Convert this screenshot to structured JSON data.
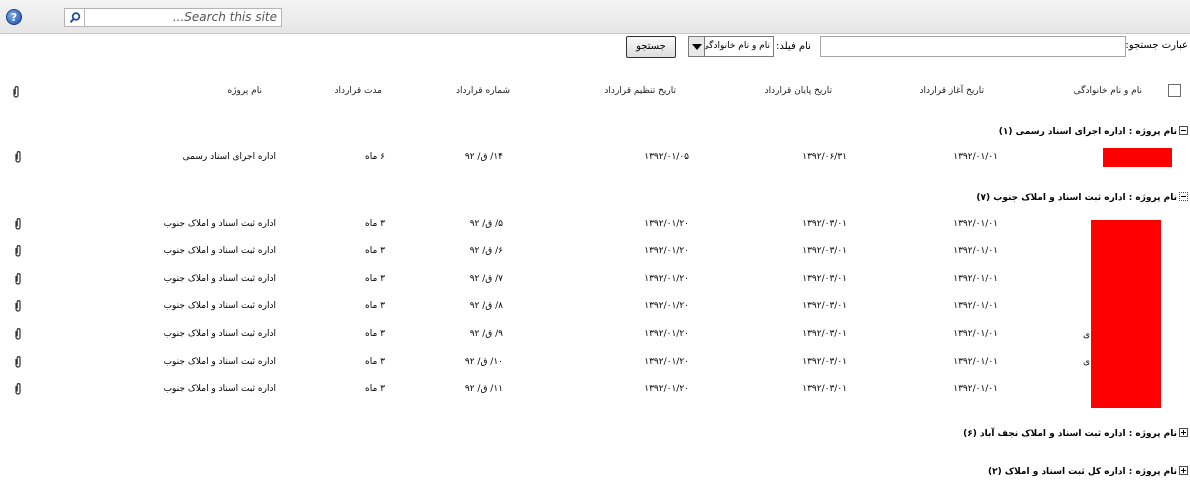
{
  "topbar": {
    "help_icon": "?",
    "site_search_placeholder": "...Search this site"
  },
  "search": {
    "label": "عبارت جستجو:",
    "field_label": "نام فیلد:",
    "field_selected": "نام و نام خانوادگی",
    "button": "جستجو"
  },
  "columns": {
    "name": "نام و نام خانوادگی",
    "start": "تاریخ آغاز قرارداد",
    "end": "تاریخ پایان قرارداد",
    "draft": "تاریخ تنظیم قرارداد",
    "number": "شماره قرارداد",
    "duration": "مدت قرارداد",
    "project": "نام پروژه"
  },
  "groups": [
    {
      "label": "نام پروژه : اداره اجرای اسناد رسمی",
      "count": "(۱)"
    },
    {
      "label": "نام پروژه : اداره ثبت اسناد و املاک جنوب",
      "count": "(۷)"
    },
    {
      "label": "نام پروژه : اداره ثبت اسناد و املاک نجف آباد",
      "count": "(۶)"
    },
    {
      "label": "نام پروژه : اداره کل ثبت اسناد و املاک",
      "count": "(۲)"
    }
  ],
  "rows": [
    {
      "start": "۱۳۹۲/۰۱/۰۱",
      "end": "۱۳۹۲/۰۶/۳۱",
      "draft": "۱۳۹۲/۰۱/۰۵",
      "number": "۱۴/ ق/ ۹۲",
      "duration": "۶ ماه",
      "project": "اداره اجرای اسناد رسمی"
    },
    {
      "start": "۱۳۹۲/۰۱/۰۱",
      "end": "۱۳۹۲/۰۳/۰۱",
      "draft": "۱۳۹۲/۰۱/۲۰",
      "number": "۵/ ق/ ۹۲",
      "duration": "۳ ماه",
      "project": "اداره ثبت اسناد و املاک جنوب"
    },
    {
      "start": "۱۳۹۲/۰۱/۰۱",
      "end": "۱۳۹۲/۰۳/۰۱",
      "draft": "۱۳۹۲/۰۱/۲۰",
      "number": "۶/ ق/ ۹۲",
      "duration": "۳ ماه",
      "project": "اداره ثبت اسناد و املاک جنوب"
    },
    {
      "start": "۱۳۹۲/۰۱/۰۱",
      "end": "۱۳۹۲/۰۳/۰۱",
      "draft": "۱۳۹۲/۰۱/۲۰",
      "number": "۷/ ق/ ۹۲",
      "duration": "۳ ماه",
      "project": "اداره ثبت اسناد و املاک جنوب"
    },
    {
      "start": "۱۳۹۲/۰۱/۰۱",
      "end": "۱۳۹۲/۰۳/۰۱",
      "draft": "۱۳۹۲/۰۱/۲۰",
      "number": "۸/ ق/ ۹۲",
      "duration": "۳ ماه",
      "project": "اداره ثبت اسناد و املاک جنوب"
    },
    {
      "start": "۱۳۹۲/۰۱/۰۱",
      "end": "۱۳۹۲/۰۳/۰۱",
      "draft": "۱۳۹۲/۰۱/۲۰",
      "number": "۹/ ق/ ۹۲",
      "duration": "۳ ماه",
      "project": "اداره ثبت اسناد و املاک جنوب"
    },
    {
      "start": "۱۳۹۲/۰۱/۰۱",
      "end": "۱۳۹۲/۰۳/۰۱",
      "draft": "۱۳۹۲/۰۱/۲۰",
      "number": "۱۰/ ق/ ۹۲",
      "duration": "۳ ماه",
      "project": "اداره ثبت اسناد و املاک جنوب"
    },
    {
      "start": "۱۳۹۲/۰۱/۰۱",
      "end": "۱۳۹۲/۰۳/۰۱",
      "draft": "۱۳۹۲/۰۱/۲۰",
      "number": "۱۱/ ق/ ۹۲",
      "duration": "۳ ماه",
      "project": "اداره ثبت اسناد و املاک جنوب"
    }
  ],
  "fragment": "ی",
  "colors": {
    "redaction": "#ff0000",
    "topbar": "#ececec"
  }
}
